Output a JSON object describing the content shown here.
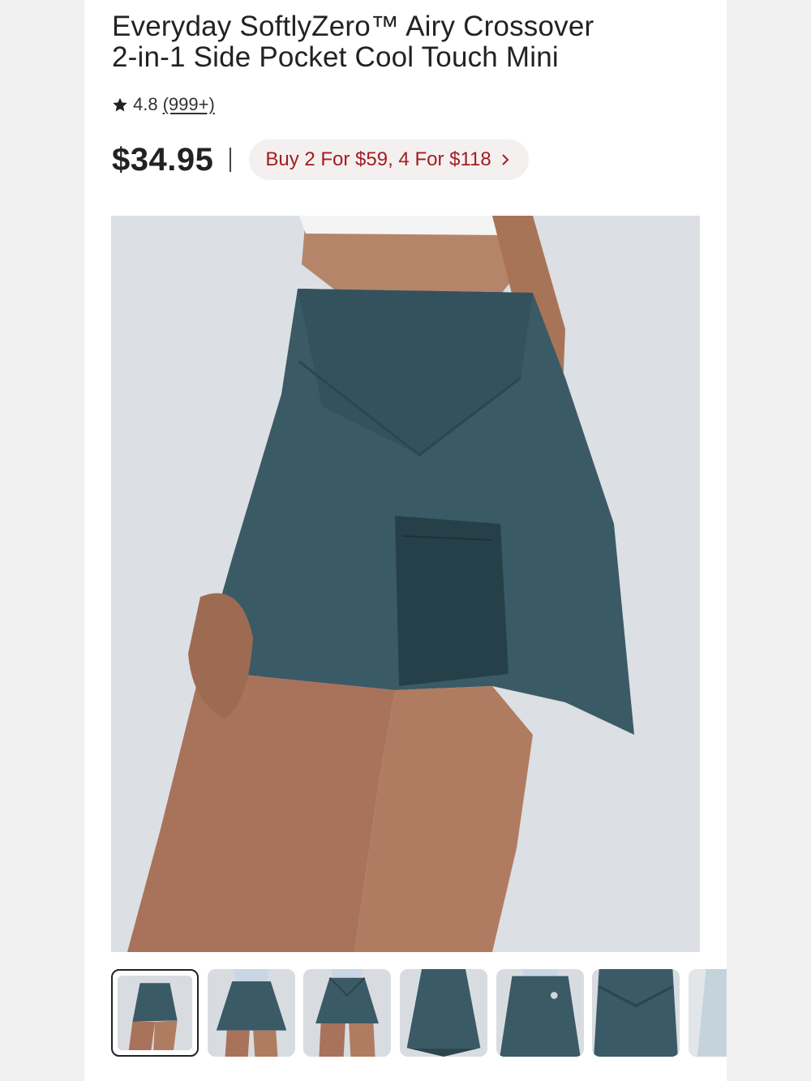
{
  "product": {
    "title": "Everyday SoftlyZero™ Airy Crossover\n2-in-1 Side Pocket Cool Touch Mini",
    "rating": "4.8",
    "review_count": "(999+)",
    "price": "$34.95",
    "price_separator": "|",
    "promo": "Buy 2 For $59, 4 For $118"
  },
  "colors": {
    "promo_text": "#a11d22",
    "skirt": "#3a5a66",
    "background": "#dcdfe3"
  },
  "icons": {
    "rating": "star-icon",
    "promo": "chevron-right-icon"
  },
  "gallery": {
    "selected_index": 0,
    "thumbnail_count": 7
  }
}
